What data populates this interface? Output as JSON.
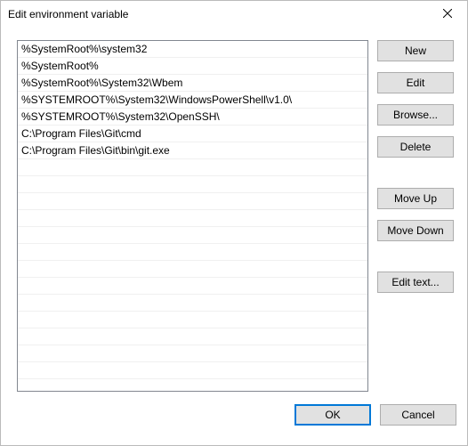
{
  "window": {
    "title": "Edit environment variable"
  },
  "entries": [
    "%SystemRoot%\\system32",
    "%SystemRoot%",
    "%SystemRoot%\\System32\\Wbem",
    "%SYSTEMROOT%\\System32\\WindowsPowerShell\\v1.0\\",
    "%SYSTEMROOT%\\System32\\OpenSSH\\",
    "C:\\Program Files\\Git\\cmd",
    "C:\\Program Files\\Git\\bin\\git.exe"
  ],
  "buttons": {
    "new": "New",
    "edit": "Edit",
    "browse": "Browse...",
    "delete": "Delete",
    "moveup": "Move Up",
    "movedown": "Move Down",
    "edittext": "Edit text...",
    "ok": "OK",
    "cancel": "Cancel"
  }
}
